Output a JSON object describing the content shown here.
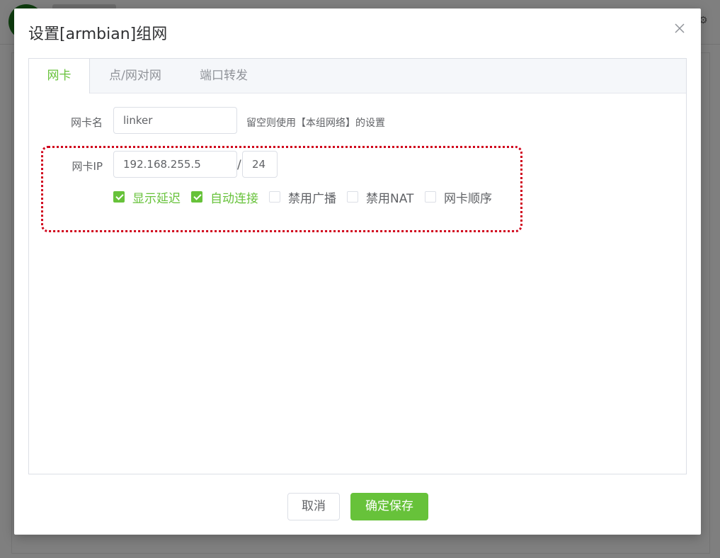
{
  "dialog": {
    "title": "设置[armbian]组网"
  },
  "tabs": [
    {
      "label": "网卡",
      "active": true
    },
    {
      "label": "点/网对网",
      "active": false
    },
    {
      "label": "端口转发",
      "active": false
    }
  ],
  "form": {
    "nic_name": {
      "label": "网卡名",
      "value": "linker",
      "hint": "留空则使用【本组网络】的设置"
    },
    "nic_ip": {
      "label": "网卡IP",
      "value": "192.168.255.5",
      "separator": "/",
      "prefix": "24"
    },
    "options": [
      {
        "label": "显示延迟",
        "checked": true
      },
      {
        "label": "自动连接",
        "checked": true
      },
      {
        "label": "禁用广播",
        "checked": false
      },
      {
        "label": "禁用NAT",
        "checked": false
      },
      {
        "label": "网卡顺序",
        "checked": false
      }
    ]
  },
  "footer": {
    "cancel_label": "取消",
    "confirm_label": "确定保存"
  },
  "colors": {
    "accent": "#67c23a",
    "highlight_border": "#d0021b"
  }
}
